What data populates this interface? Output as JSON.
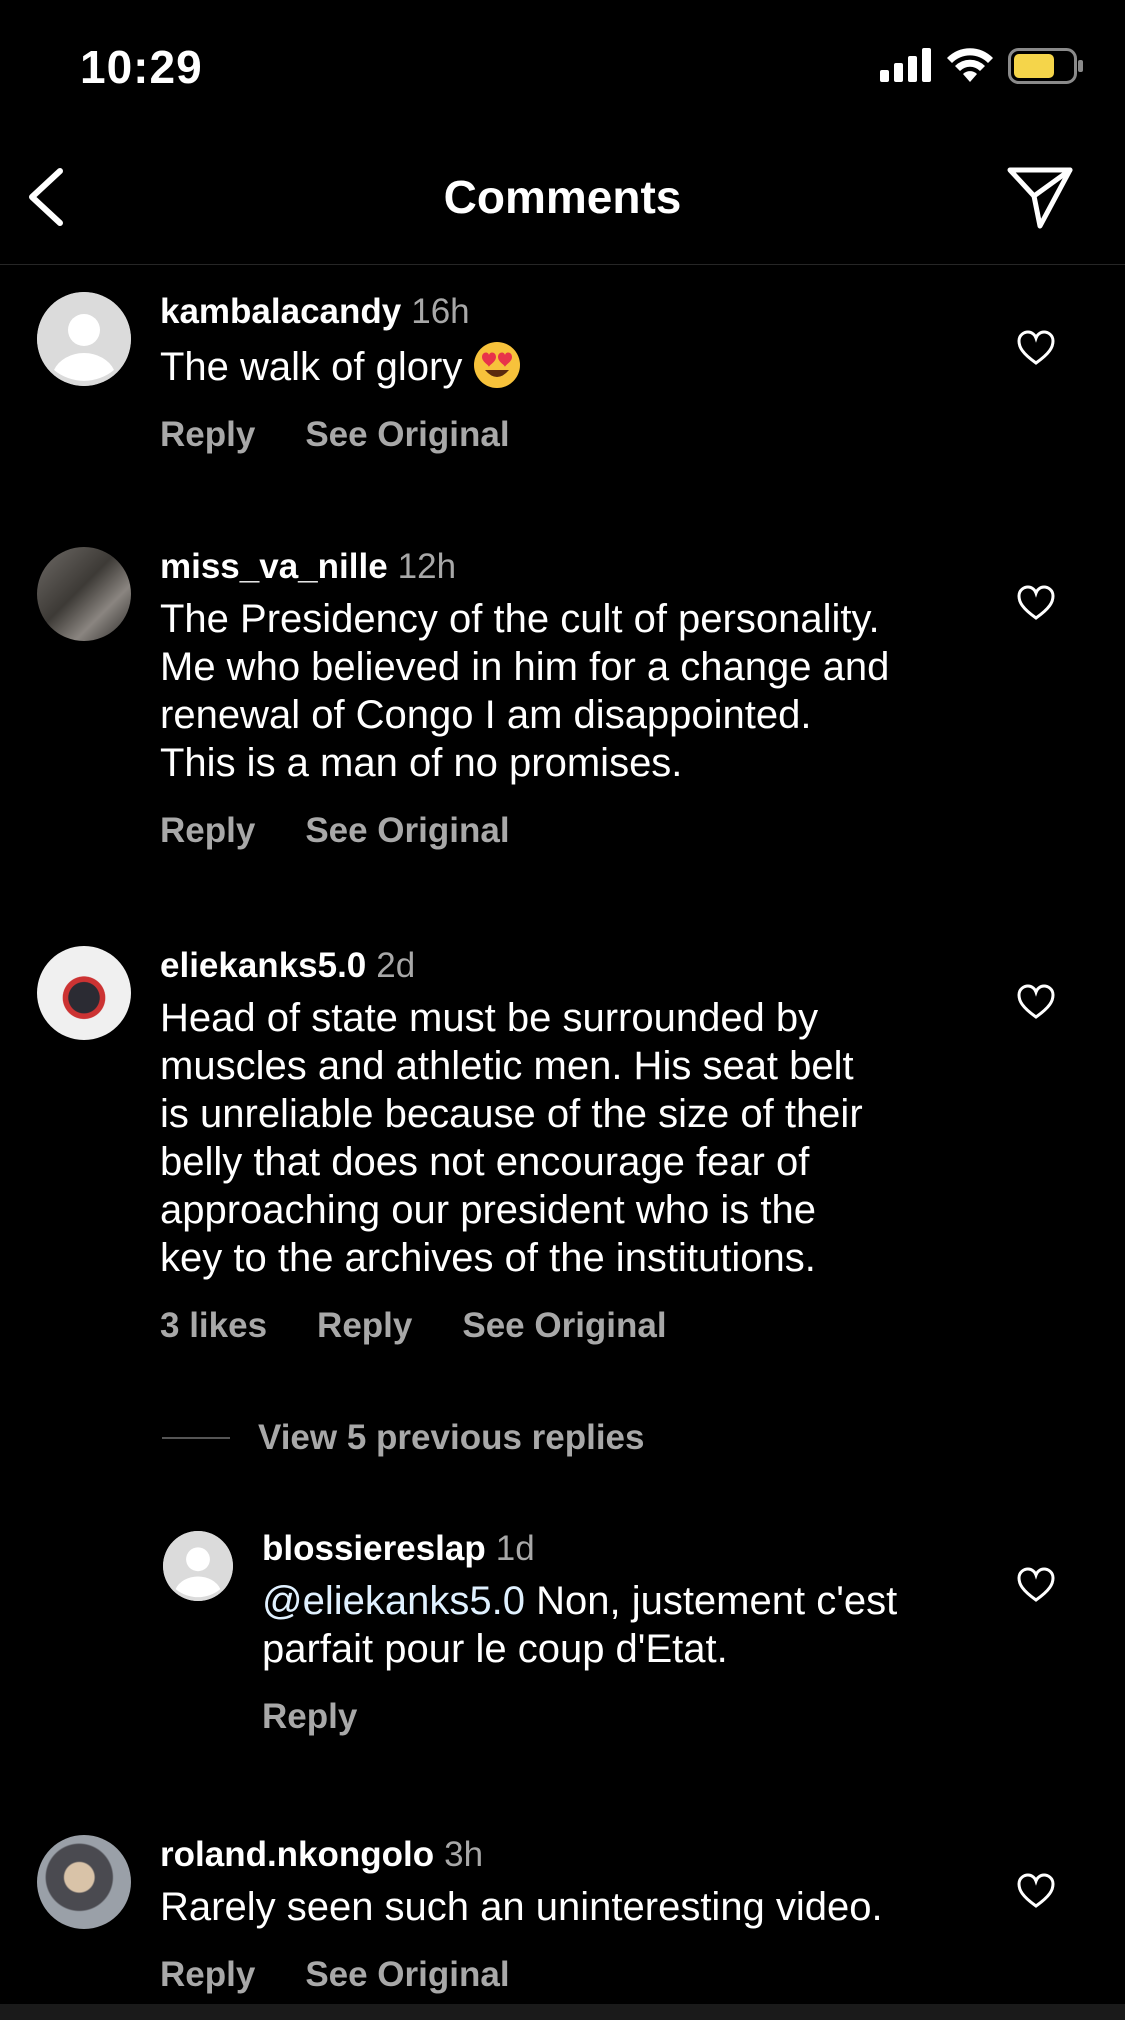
{
  "status_bar": {
    "time": "10:29"
  },
  "header": {
    "title": "Comments",
    "back_icon": "chevron-left-icon",
    "share_icon": "paper-plane-icon"
  },
  "comments": [
    {
      "username": "kambalacandy",
      "time": "16h",
      "text": "The walk of glory",
      "emoji": "heart-eyes-emoji",
      "reply": "Reply",
      "see_original": "See Original"
    },
    {
      "username": "miss_va_nille",
      "time": "12h",
      "text": "The Presidency of the cult of personality.\nMe who believed in him for a change and\nrenewal of Congo I am disappointed.\nThis is a man of no promises.",
      "reply": "Reply",
      "see_original": "See Original"
    },
    {
      "username": "eliekanks5.0",
      "time": "2d",
      "text": "Head of state must be surrounded by\nmuscles and athletic men. His seat belt\nis unreliable because of the size of their\nbelly that does not encourage fear of\napproaching our president who is the\nkey to the archives of the institutions.",
      "likes": "3 likes",
      "reply": "Reply",
      "see_original": "See Original",
      "view_replies": "View 5 previous replies",
      "replies": [
        {
          "username": "blossiereslap",
          "time": "1d",
          "mention": "@eliekanks5.0",
          "text_after_mention": " Non, justement c'est\nparfait pour le coup d'Etat.",
          "reply": "Reply"
        }
      ]
    },
    {
      "username": "roland.nkongolo",
      "time": "3h",
      "text": "Rarely seen such an uninteresting video.",
      "reply": "Reply",
      "see_original": "See Original"
    }
  ],
  "colors": {
    "background": "#000000",
    "secondary_text": "#a8a8a8",
    "battery": "#f5d54a"
  }
}
